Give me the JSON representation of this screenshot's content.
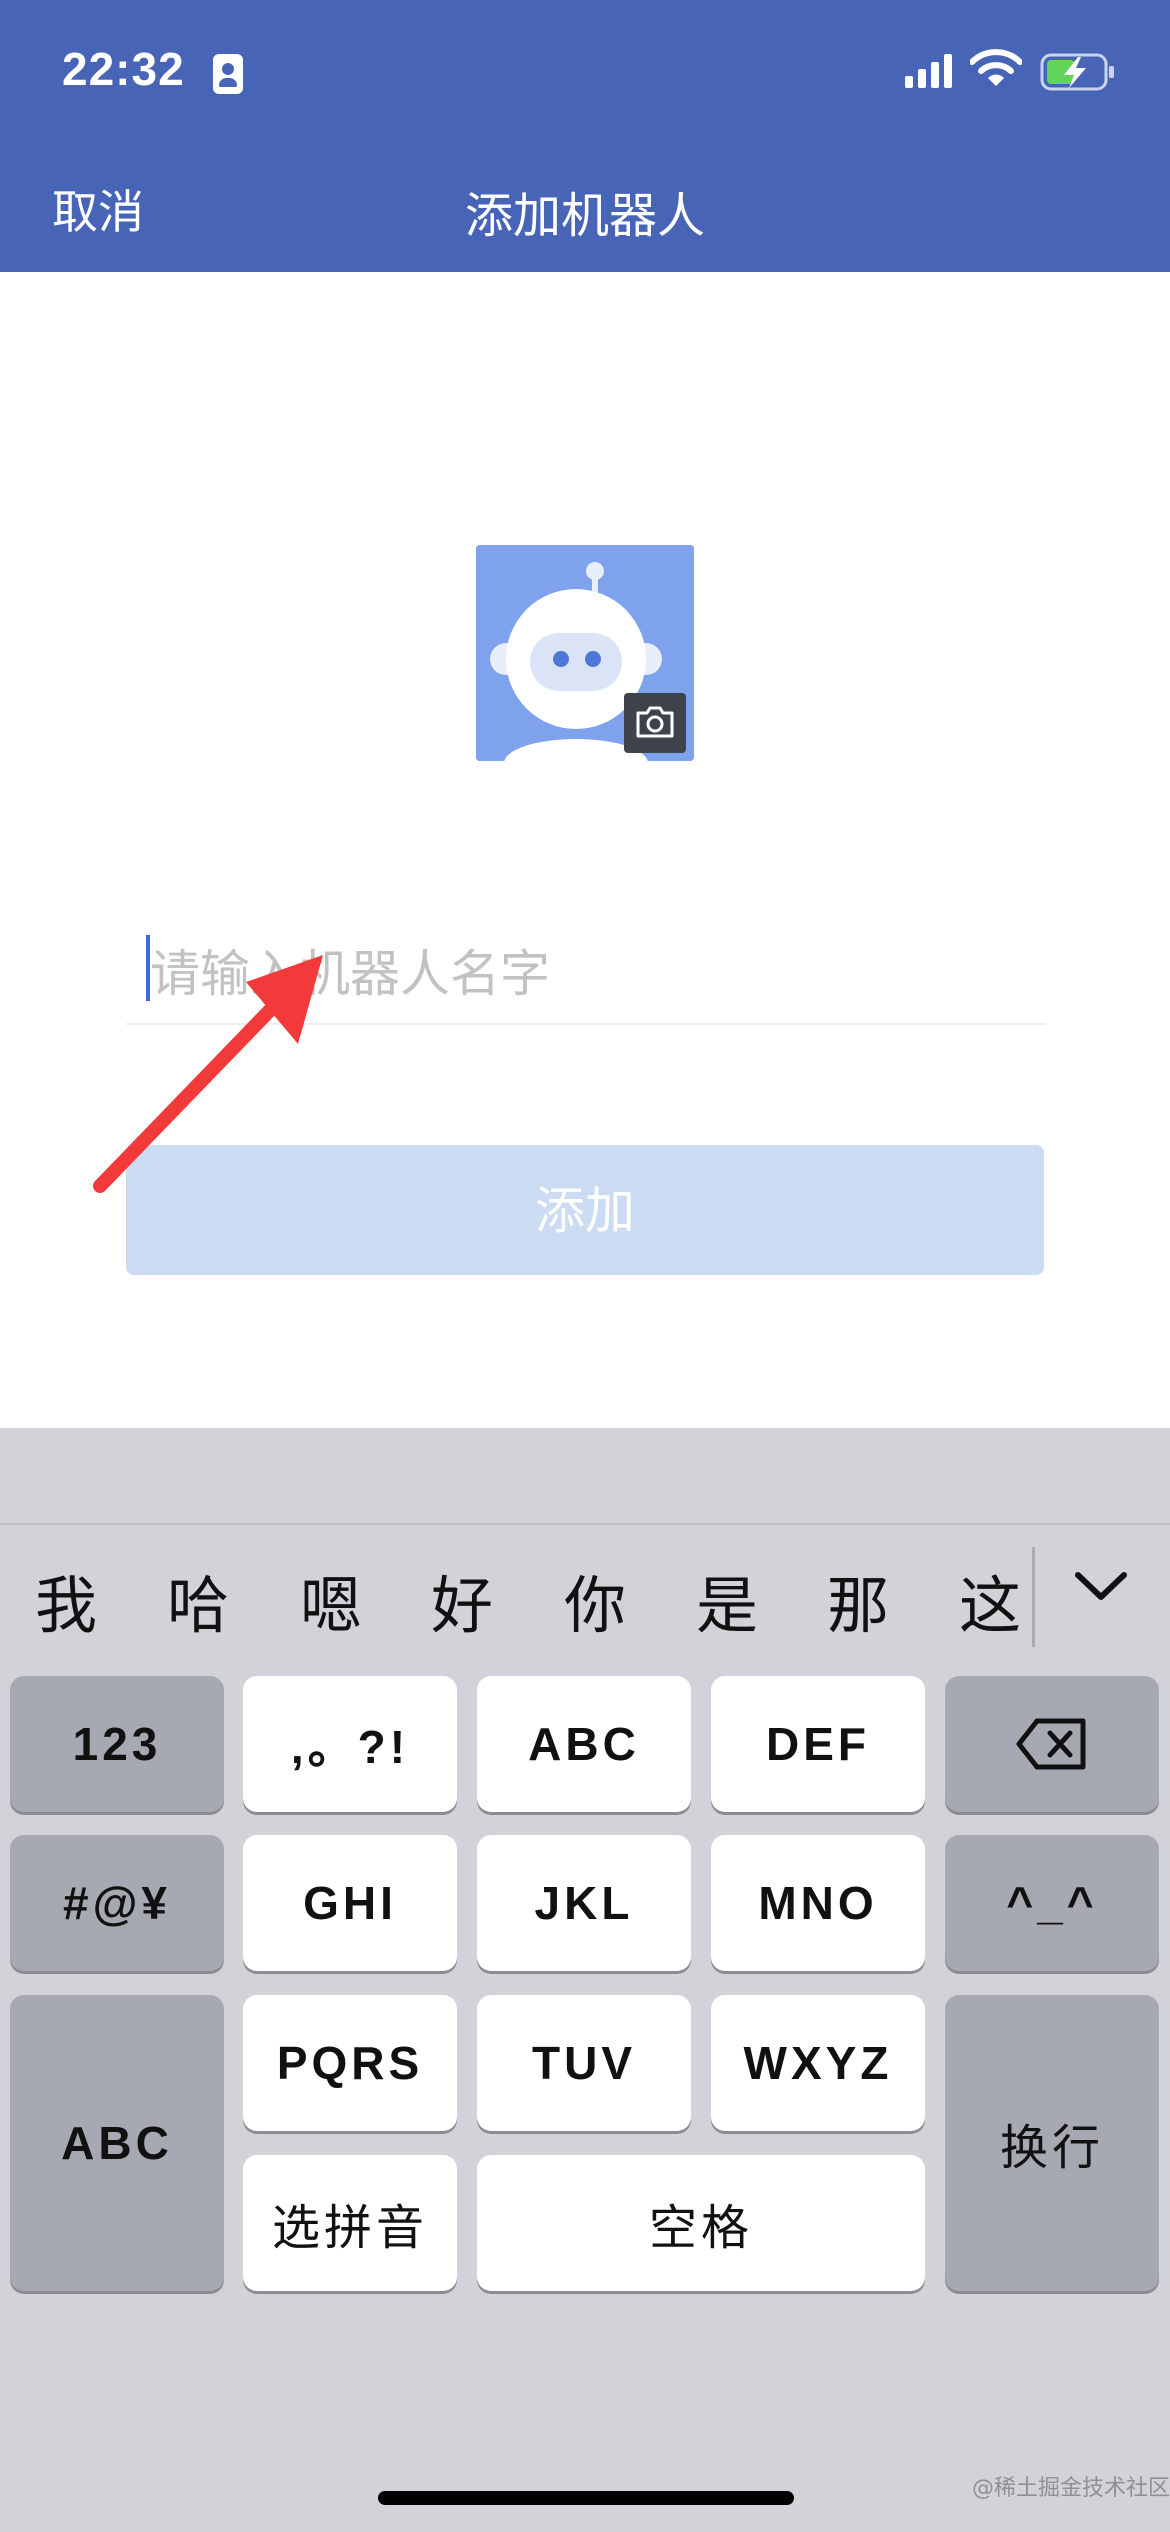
{
  "status_bar": {
    "time": "22:32"
  },
  "nav": {
    "cancel_label": "取消",
    "title": "添加机器人"
  },
  "form": {
    "name_placeholder": "请输入机器人名字",
    "name_value": "",
    "add_label": "添加"
  },
  "keyboard": {
    "candidates": [
      "我",
      "哈",
      "嗯",
      "好",
      "你",
      "是",
      "那",
      "这"
    ],
    "keys": {
      "num": "123",
      "punct": ",。?!",
      "abc": "ABC",
      "def": "DEF",
      "symbols": "#@¥",
      "ghi": "GHI",
      "jkl": "JKL",
      "mno": "MNO",
      "emoticon": "^_^",
      "abc_switch": "ABC",
      "pqrs": "PQRS",
      "tuv": "TUV",
      "wxyz": "WXYZ",
      "newline": "换行",
      "pinyin_select": "选拼音",
      "space": "空格"
    }
  },
  "watermark": "@稀土掘金技术社区",
  "colors": {
    "header_bg": "#4764b6",
    "add_button_bg": "#cbdbf1",
    "keyboard_bg": "#d1d3d9",
    "annotation_arrow": "#f23a3a"
  }
}
